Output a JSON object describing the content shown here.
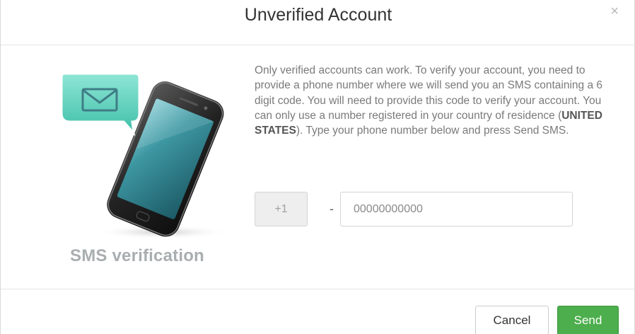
{
  "dialog": {
    "title": "Unverified Account",
    "close_symbol": "×"
  },
  "illustration": {
    "caption": "SMS verification",
    "icons": [
      "phone-icon",
      "envelope-icon",
      "speech-bubble-icon"
    ],
    "bubble_color": "#5fd2bd",
    "phone_screen_color": "#2f7e88"
  },
  "description": {
    "text_before": "Only verified accounts can work. To verify your account, you need to provide a phone number where we will send you an SMS containing a 6 digit code. You will need to provide this code to verify your account. You can only use a number registered in your country of residence (",
    "country": "UNITED STATES",
    "text_after": "). Type your phone number below and press Send SMS."
  },
  "phone_form": {
    "country_code": "+1",
    "separator": "-",
    "placeholder": "00000000000",
    "value": ""
  },
  "footer": {
    "cancel_label": "Cancel",
    "send_label": "Send",
    "send_color": "#4cae4c"
  }
}
